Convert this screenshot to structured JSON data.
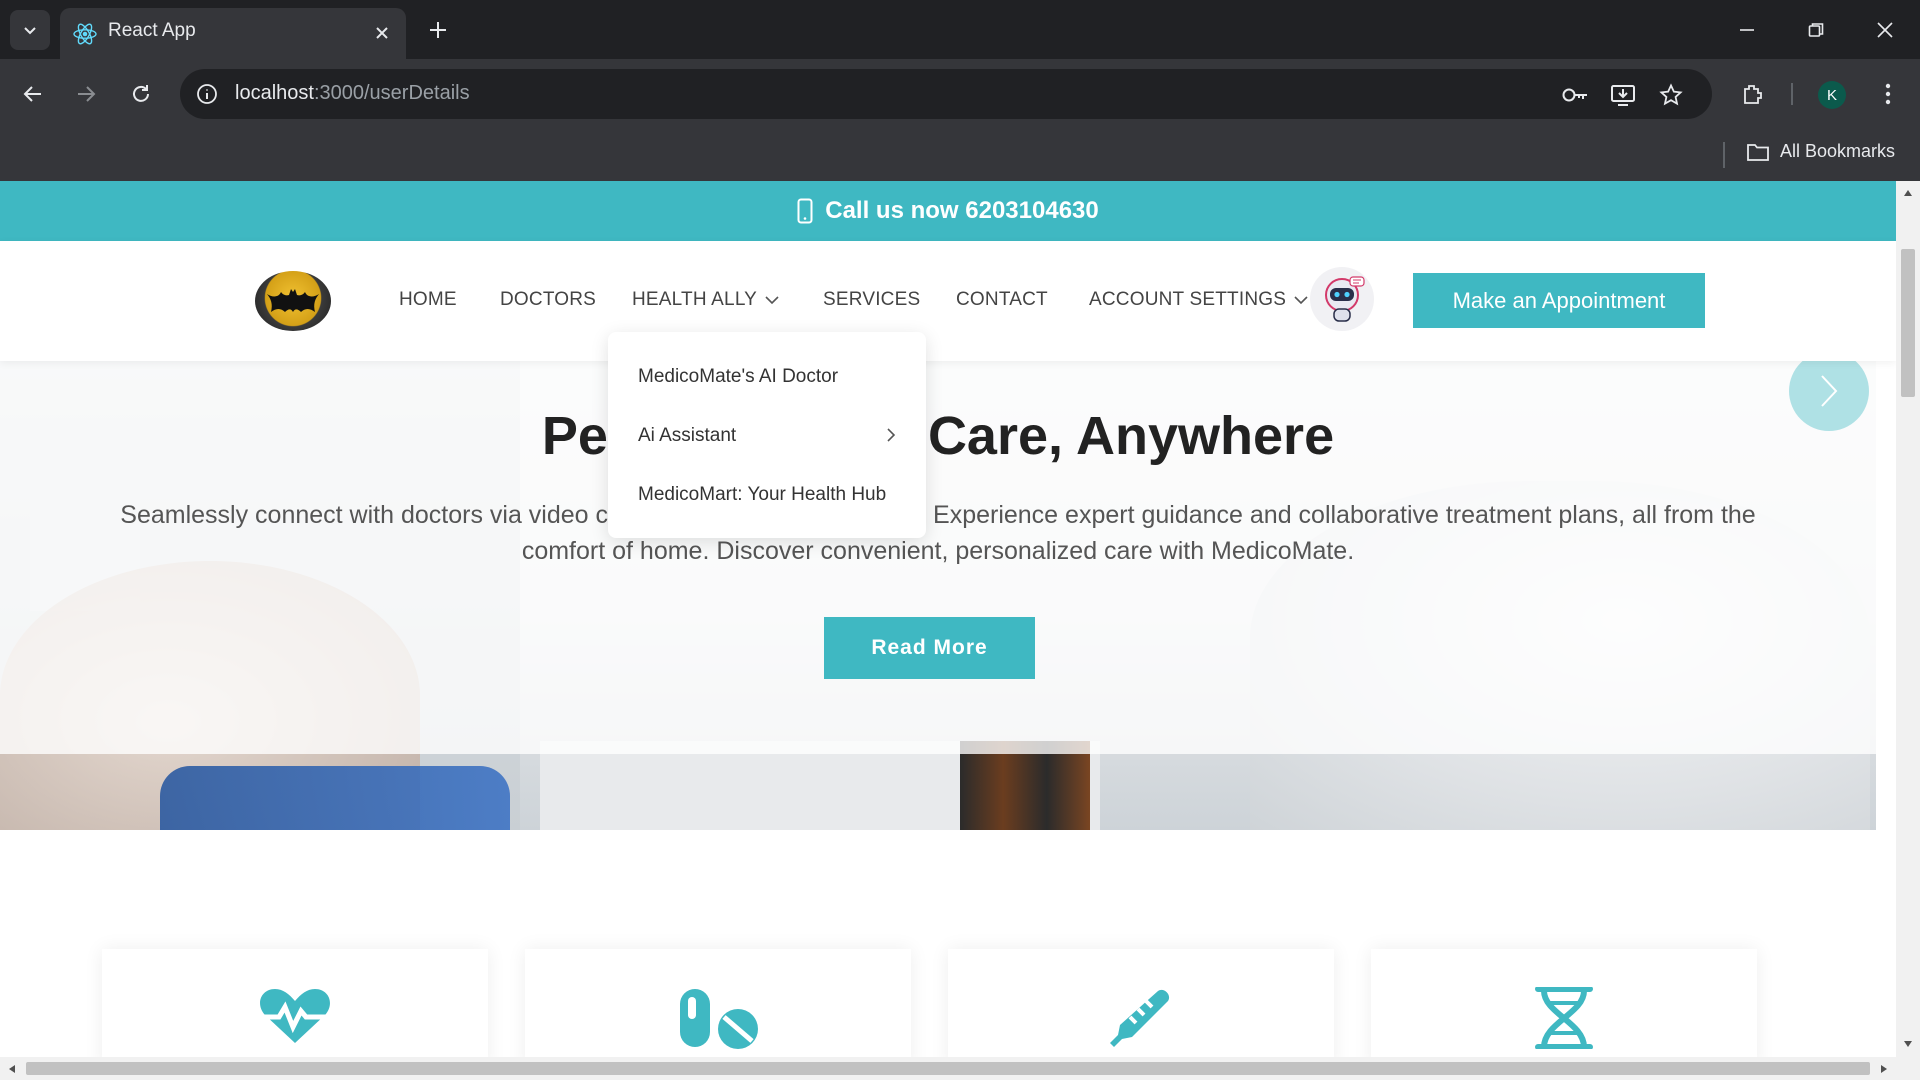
{
  "browser": {
    "tab_title": "React App",
    "url_host": "localhost",
    "url_rest": ":3000/userDetails",
    "profile_initial": "K",
    "bookmarks_label": "All Bookmarks"
  },
  "topbar": {
    "call_text": "Call us now 6203104630",
    "icon": "mobile-phone-icon"
  },
  "nav": {
    "items": [
      {
        "label": "HOME"
      },
      {
        "label": "DOCTORS"
      },
      {
        "label": "HEALTH ALLY"
      },
      {
        "label": "SERVICES"
      },
      {
        "label": "CONTACT"
      },
      {
        "label": "ACCOUNT SETTINGS"
      }
    ],
    "appointment_button": "Make an Appointment"
  },
  "dropdown": {
    "items": [
      {
        "label": "MedicoMate's AI Doctor"
      },
      {
        "label": "Ai Assistant"
      },
      {
        "label": "MedicoMart: Your Health Hub"
      }
    ]
  },
  "hero": {
    "title_left": "Pe",
    "title_right": "Care, Anywhere",
    "text_line1_left": "Seamlessly connect with doctors via video call",
    "text_line1_right": "Experience expert guidance and collaborative treatment plans, all from the",
    "text_line2": "comfort of home. Discover convenient, personalized care with MedicoMate.",
    "read_more": "Read More"
  },
  "cards": [
    {
      "icon": "heartbeat-icon"
    },
    {
      "icon": "pills-icon"
    },
    {
      "icon": "syringe-icon"
    },
    {
      "icon": "dna-icon"
    }
  ],
  "colors": {
    "accent": "#3fb8c2",
    "chrome_dark": "#202124",
    "chrome_mid": "#35363a"
  }
}
